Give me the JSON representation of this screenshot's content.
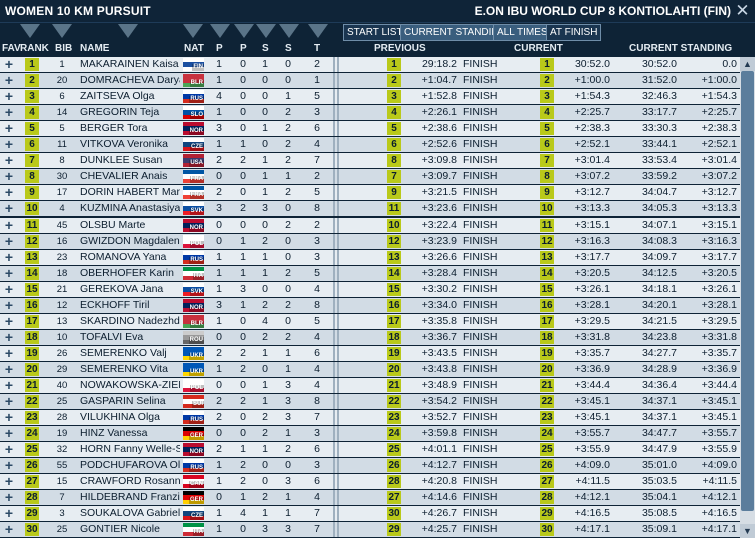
{
  "window": {
    "title_left": "WOMEN 10 KM PURSUIT",
    "title_right": "E.ON IBU WORLD CUP 8 KONTIOLAHTI (FIN)"
  },
  "toolbar": {
    "start_list": "START LIST",
    "current_standing": "CURRENT STANDING",
    "all_times": "ALL TIMES",
    "at_finish": "AT FINISH"
  },
  "columns": {
    "fav": "FAV",
    "rank": "RANK",
    "bib": "BIB",
    "name": "NAME",
    "nat": "NAT",
    "p1": "P",
    "p2": "P",
    "s1": "S",
    "s2": "S",
    "t": "T",
    "previous": "PREVIOUS",
    "current": "CURRENT",
    "current_standing": "CURRENT STANDING"
  },
  "flag_colors": {
    "FIN": [
      "#ffffff",
      "#1a4fa0",
      "#ffffff"
    ],
    "BLR": [
      "#c8313e",
      "#c8313e",
      "#4aa657"
    ],
    "RUS": [
      "#ffffff",
      "#0039a6",
      "#d52b1e"
    ],
    "SLO": [
      "#ffffff",
      "#0052a5",
      "#d50000"
    ],
    "NOR": [
      "#ba0c2f",
      "#00205b",
      "#ba0c2f"
    ],
    "CZE": [
      "#ffffff",
      "#11457e",
      "#d7141a"
    ],
    "USA": [
      "#b22234",
      "#3c3b6e",
      "#b22234"
    ],
    "FRA": [
      "#0055a4",
      "#ffffff",
      "#ef4135"
    ],
    "SVK": [
      "#ffffff",
      "#0b4ea2",
      "#ee1c25"
    ],
    "POL": [
      "#ffffff",
      "#ffffff",
      "#dc143c"
    ],
    "ITA": [
      "#009246",
      "#ffffff",
      "#ce2b37"
    ],
    "UKR": [
      "#0057b7",
      "#0057b7",
      "#ffd700"
    ],
    "SUI": [
      "#d52b1e",
      "#ffffff",
      "#d52b1e"
    ],
    "GER": [
      "#000000",
      "#dd0000",
      "#ffce00"
    ],
    "CAN": [
      "#d80621",
      "#ffffff",
      "#d80621"
    ]
  },
  "rows": [
    {
      "rank": "1",
      "bib": "1",
      "name": "MAKARAINEN Kaisa",
      "nat": "FIN",
      "p1": "1",
      "p2": "0",
      "s1": "1",
      "s2": "0",
      "t": "2",
      "prev_rank": "1",
      "prev_time": "29:18.2",
      "prev_status": "FINISH",
      "cur_rank": "1",
      "cur_diff": "30:52.0",
      "st_time": "30:52.0",
      "st_diff": "0.0"
    },
    {
      "rank": "2",
      "bib": "20",
      "name": "DOMRACHEVA Darya",
      "nat": "BLR",
      "p1": "1",
      "p2": "0",
      "s1": "0",
      "s2": "0",
      "t": "1",
      "prev_rank": "2",
      "prev_time": "+1:04.7",
      "prev_status": "FINISH",
      "cur_rank": "2",
      "cur_diff": "+1:00.0",
      "st_time": "31:52.0",
      "st_diff": "+1:00.0"
    },
    {
      "rank": "3",
      "bib": "6",
      "name": "ZAITSEVA Olga",
      "nat": "RUS",
      "p1": "4",
      "p2": "0",
      "s1": "0",
      "s2": "1",
      "t": "5",
      "prev_rank": "3",
      "prev_time": "+1:52.8",
      "prev_status": "FINISH",
      "cur_rank": "3",
      "cur_diff": "+1:54.3",
      "st_time": "32:46.3",
      "st_diff": "+1:54.3"
    },
    {
      "rank": "4",
      "bib": "14",
      "name": "GREGORIN Teja",
      "nat": "SLO",
      "p1": "1",
      "p2": "0",
      "s1": "0",
      "s2": "2",
      "t": "3",
      "prev_rank": "4",
      "prev_time": "+2:26.1",
      "prev_status": "FINISH",
      "cur_rank": "4",
      "cur_diff": "+2:25.7",
      "st_time": "33:17.7",
      "st_diff": "+2:25.7"
    },
    {
      "rank": "5",
      "bib": "5",
      "name": "BERGER Tora",
      "nat": "NOR",
      "p1": "3",
      "p2": "0",
      "s1": "1",
      "s2": "2",
      "t": "6",
      "prev_rank": "5",
      "prev_time": "+2:38.6",
      "prev_status": "FINISH",
      "cur_rank": "5",
      "cur_diff": "+2:38.3",
      "st_time": "33:30.3",
      "st_diff": "+2:38.3"
    },
    {
      "rank": "6",
      "bib": "11",
      "name": "VITKOVA Veronika",
      "nat": "CZE",
      "p1": "1",
      "p2": "1",
      "s1": "0",
      "s2": "2",
      "t": "4",
      "prev_rank": "6",
      "prev_time": "+2:52.6",
      "prev_status": "FINISH",
      "cur_rank": "6",
      "cur_diff": "+2:52.1",
      "st_time": "33:44.1",
      "st_diff": "+2:52.1"
    },
    {
      "rank": "7",
      "bib": "8",
      "name": "DUNKLEE Susan",
      "nat": "USA",
      "p1": "2",
      "p2": "2",
      "s1": "1",
      "s2": "2",
      "t": "7",
      "prev_rank": "8",
      "prev_time": "+3:09.8",
      "prev_status": "FINISH",
      "cur_rank": "7",
      "cur_diff": "+3:01.4",
      "st_time": "33:53.4",
      "st_diff": "+3:01.4"
    },
    {
      "rank": "8",
      "bib": "30",
      "name": "CHEVALIER Anais",
      "nat": "FRA",
      "p1": "0",
      "p2": "0",
      "s1": "1",
      "s2": "1",
      "t": "2",
      "prev_rank": "7",
      "prev_time": "+3:09.7",
      "prev_status": "FINISH",
      "cur_rank": "8",
      "cur_diff": "+3:07.2",
      "st_time": "33:59.2",
      "st_diff": "+3:07.2"
    },
    {
      "rank": "9",
      "bib": "17",
      "name": "DORIN HABERT Marie",
      "nat": "FRA",
      "p1": "2",
      "p2": "0",
      "s1": "1",
      "s2": "2",
      "t": "5",
      "prev_rank": "9",
      "prev_time": "+3:21.5",
      "prev_status": "FINISH",
      "cur_rank": "9",
      "cur_diff": "+3:12.7",
      "st_time": "34:04.7",
      "st_diff": "+3:12.7"
    },
    {
      "rank": "10",
      "bib": "4",
      "name": "KUZMINA Anastasiya",
      "nat": "SVK",
      "p1": "3",
      "p2": "2",
      "s1": "3",
      "s2": "0",
      "t": "8",
      "prev_rank": "11",
      "prev_time": "+3:23.6",
      "prev_status": "FINISH",
      "cur_rank": "10",
      "cur_diff": "+3:13.3",
      "st_time": "34:05.3",
      "st_diff": "+3:13.3"
    },
    {
      "rank": "11",
      "bib": "45",
      "name": "OLSBU Marte",
      "nat": "NOR",
      "p1": "0",
      "p2": "0",
      "s1": "0",
      "s2": "2",
      "t": "2",
      "prev_rank": "10",
      "prev_time": "+3:22.4",
      "prev_status": "FINISH",
      "cur_rank": "11",
      "cur_diff": "+3:15.1",
      "st_time": "34:07.1",
      "st_diff": "+3:15.1"
    },
    {
      "rank": "12",
      "bib": "16",
      "name": "GWIZDON Magdalena",
      "nat": "POL",
      "p1": "0",
      "p2": "1",
      "s1": "2",
      "s2": "0",
      "t": "3",
      "prev_rank": "12",
      "prev_time": "+3:23.9",
      "prev_status": "FINISH",
      "cur_rank": "12",
      "cur_diff": "+3:16.3",
      "st_time": "34:08.3",
      "st_diff": "+3:16.3"
    },
    {
      "rank": "13",
      "bib": "23",
      "name": "ROMANOVA Yana",
      "nat": "RUS",
      "p1": "1",
      "p2": "1",
      "s1": "1",
      "s2": "0",
      "t": "3",
      "prev_rank": "13",
      "prev_time": "+3:26.6",
      "prev_status": "FINISH",
      "cur_rank": "13",
      "cur_diff": "+3:17.7",
      "st_time": "34:09.7",
      "st_diff": "+3:17.7"
    },
    {
      "rank": "14",
      "bib": "18",
      "name": "OBERHOFER Karin",
      "nat": "ITA",
      "p1": "1",
      "p2": "1",
      "s1": "1",
      "s2": "2",
      "t": "5",
      "prev_rank": "14",
      "prev_time": "+3:28.4",
      "prev_status": "FINISH",
      "cur_rank": "14",
      "cur_diff": "+3:20.5",
      "st_time": "34:12.5",
      "st_diff": "+3:20.5"
    },
    {
      "rank": "15",
      "bib": "21",
      "name": "GEREKOVA Jana",
      "nat": "SVK",
      "p1": "1",
      "p2": "3",
      "s1": "0",
      "s2": "0",
      "t": "4",
      "prev_rank": "15",
      "prev_time": "+3:30.2",
      "prev_status": "FINISH",
      "cur_rank": "15",
      "cur_diff": "+3:26.1",
      "st_time": "34:18.1",
      "st_diff": "+3:26.1"
    },
    {
      "rank": "16",
      "bib": "12",
      "name": "ECKHOFF Tiril",
      "nat": "NOR",
      "p1": "3",
      "p2": "1",
      "s1": "2",
      "s2": "2",
      "t": "8",
      "prev_rank": "16",
      "prev_time": "+3:34.0",
      "prev_status": "FINISH",
      "cur_rank": "16",
      "cur_diff": "+3:28.1",
      "st_time": "34:20.1",
      "st_diff": "+3:28.1"
    },
    {
      "rank": "17",
      "bib": "13",
      "name": "SKARDINO Nadezhda",
      "nat": "BLR",
      "p1": "1",
      "p2": "0",
      "s1": "4",
      "s2": "0",
      "t": "5",
      "prev_rank": "17",
      "prev_time": "+3:35.8",
      "prev_status": "FINISH",
      "cur_rank": "17",
      "cur_diff": "+3:29.5",
      "st_time": "34:21.5",
      "st_diff": "+3:29.5"
    },
    {
      "rank": "18",
      "bib": "10",
      "name": "TOFALVI Eva",
      "nat": "ROU",
      "p1": "0",
      "p2": "0",
      "s1": "2",
      "s2": "2",
      "t": "4",
      "prev_rank": "18",
      "prev_time": "+3:36.7",
      "prev_status": "FINISH",
      "cur_rank": "18",
      "cur_diff": "+3:31.8",
      "st_time": "34:23.8",
      "st_diff": "+3:31.8"
    },
    {
      "rank": "19",
      "bib": "26",
      "name": "SEMERENKO Valj",
      "nat": "UKR",
      "p1": "2",
      "p2": "2",
      "s1": "1",
      "s2": "1",
      "t": "6",
      "prev_rank": "19",
      "prev_time": "+3:43.5",
      "prev_status": "FINISH",
      "cur_rank": "19",
      "cur_diff": "+3:35.7",
      "st_time": "34:27.7",
      "st_diff": "+3:35.7"
    },
    {
      "rank": "20",
      "bib": "29",
      "name": "SEMERENKO Vita",
      "nat": "UKR",
      "p1": "1",
      "p2": "2",
      "s1": "0",
      "s2": "1",
      "t": "4",
      "prev_rank": "20",
      "prev_time": "+3:43.8",
      "prev_status": "FINISH",
      "cur_rank": "20",
      "cur_diff": "+3:36.9",
      "st_time": "34:28.9",
      "st_diff": "+3:36.9"
    },
    {
      "rank": "21",
      "bib": "40",
      "name": "NOWAKOWSKA-ZIEMN",
      "nat": "POL",
      "p1": "0",
      "p2": "0",
      "s1": "1",
      "s2": "3",
      "t": "4",
      "prev_rank": "21",
      "prev_time": "+3:48.9",
      "prev_status": "FINISH",
      "cur_rank": "21",
      "cur_diff": "+3:44.4",
      "st_time": "34:36.4",
      "st_diff": "+3:44.4"
    },
    {
      "rank": "22",
      "bib": "25",
      "name": "GASPARIN Selina",
      "nat": "SUI",
      "p1": "2",
      "p2": "2",
      "s1": "1",
      "s2": "3",
      "t": "8",
      "prev_rank": "22",
      "prev_time": "+3:54.2",
      "prev_status": "FINISH",
      "cur_rank": "22",
      "cur_diff": "+3:45.1",
      "st_time": "34:37.1",
      "st_diff": "+3:45.1"
    },
    {
      "rank": "23",
      "bib": "28",
      "name": "VILUKHINA Olga",
      "nat": "RUS",
      "p1": "2",
      "p2": "0",
      "s1": "2",
      "s2": "3",
      "t": "7",
      "prev_rank": "23",
      "prev_time": "+3:52.7",
      "prev_status": "FINISH",
      "cur_rank": "23",
      "cur_diff": "+3:45.1",
      "st_time": "34:37.1",
      "st_diff": "+3:45.1"
    },
    {
      "rank": "24",
      "bib": "19",
      "name": "HINZ Vanessa",
      "nat": "GER",
      "p1": "0",
      "p2": "0",
      "s1": "2",
      "s2": "1",
      "t": "3",
      "prev_rank": "24",
      "prev_time": "+3:59.8",
      "prev_status": "FINISH",
      "cur_rank": "24",
      "cur_diff": "+3:55.7",
      "st_time": "34:47.7",
      "st_diff": "+3:55.7"
    },
    {
      "rank": "25",
      "bib": "32",
      "name": "HORN Fanny Welle-St",
      "nat": "NOR",
      "p1": "2",
      "p2": "1",
      "s1": "1",
      "s2": "2",
      "t": "6",
      "prev_rank": "25",
      "prev_time": "+4:01.1",
      "prev_status": "FINISH",
      "cur_rank": "25",
      "cur_diff": "+3:55.9",
      "st_time": "34:47.9",
      "st_diff": "+3:55.9"
    },
    {
      "rank": "26",
      "bib": "55",
      "name": "PODCHUFAROVA Olga",
      "nat": "RUS",
      "p1": "1",
      "p2": "2",
      "s1": "0",
      "s2": "0",
      "t": "3",
      "prev_rank": "26",
      "prev_time": "+4:12.7",
      "prev_status": "FINISH",
      "cur_rank": "26",
      "cur_diff": "+4:09.0",
      "st_time": "35:01.0",
      "st_diff": "+4:09.0"
    },
    {
      "rank": "27",
      "bib": "15",
      "name": "CRAWFORD Rosanna",
      "nat": "CAN",
      "p1": "1",
      "p2": "2",
      "s1": "0",
      "s2": "3",
      "t": "6",
      "prev_rank": "28",
      "prev_time": "+4:20.8",
      "prev_status": "FINISH",
      "cur_rank": "27",
      "cur_diff": "+4:11.5",
      "st_time": "35:03.5",
      "st_diff": "+4:11.5"
    },
    {
      "rank": "28",
      "bib": "7",
      "name": "HILDEBRAND Franzisk",
      "nat": "GER",
      "p1": "0",
      "p2": "1",
      "s1": "2",
      "s2": "1",
      "t": "4",
      "prev_rank": "27",
      "prev_time": "+4:14.6",
      "prev_status": "FINISH",
      "cur_rank": "28",
      "cur_diff": "+4:12.1",
      "st_time": "35:04.1",
      "st_diff": "+4:12.1"
    },
    {
      "rank": "29",
      "bib": "3",
      "name": "SOUKALOVA Gabriela",
      "nat": "CZE",
      "p1": "1",
      "p2": "4",
      "s1": "1",
      "s2": "1",
      "t": "7",
      "prev_rank": "30",
      "prev_time": "+4:26.7",
      "prev_status": "FINISH",
      "cur_rank": "29",
      "cur_diff": "+4:16.5",
      "st_time": "35:08.5",
      "st_diff": "+4:16.5"
    },
    {
      "rank": "30",
      "bib": "25",
      "name": "GONTIER Nicole",
      "nat": "ITA",
      "p1": "1",
      "p2": "0",
      "s1": "3",
      "s2": "3",
      "t": "7",
      "prev_rank": "29",
      "prev_time": "+4:25.7",
      "prev_status": "FINISH",
      "cur_rank": "30",
      "cur_diff": "+4:17.1",
      "st_time": "35:09.1",
      "st_diff": "+4:17.1"
    }
  ]
}
